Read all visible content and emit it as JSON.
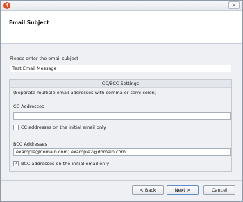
{
  "window": {
    "app_icon_glyph": "4",
    "close_glyph": "×"
  },
  "header": {
    "title": "Email Subject"
  },
  "subject": {
    "prompt": "Please enter the email subject",
    "value": "Test Email Message"
  },
  "ccbcc": {
    "group_title": "CC/BCC Settings",
    "hint": "(Separate multiple email addresses with comma or semi-colon)",
    "cc_label": "CC Addresses",
    "cc_value": "",
    "cc_checkbox_label": "CC addresses on the initial email only",
    "cc_checked": false,
    "bcc_label": "BCC Addresses",
    "bcc_value": "example@domain.com; example2@domain.com",
    "bcc_checkbox_label": "BCC addresses on the initial email only",
    "bcc_checked": true,
    "check_glyph": "✓"
  },
  "buttons": {
    "back": "< Back",
    "next": "Next >",
    "cancel": "Cancel"
  }
}
